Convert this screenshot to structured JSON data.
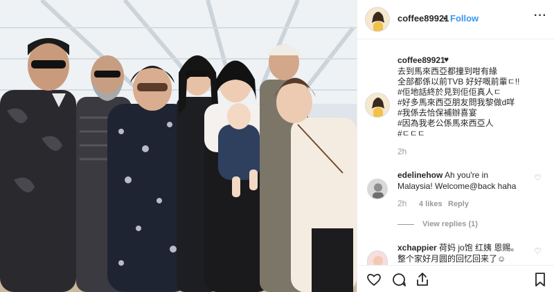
{
  "post": {
    "username": "coffee89921",
    "dot": "•",
    "follow_label": "Follow",
    "more_label": "···",
    "caption_heart": "♥",
    "caption_lines": [
      "去到馬來西亞都撞到咁有緣",
      "全部都係以前TVB 好好嘅前輩ㄷ!!",
      "#佢地話終於見到佢佢真人ㄷ",
      "#好多馬來西亞朋友問我黎做d咩",
      "#我係去恰保補辦喜宴",
      "#因為我老公係馬來西亞人",
      "#ㄷㄷㄷ"
    ],
    "caption_time": "2h"
  },
  "comments": [
    {
      "username": "edelinehow",
      "text_line1": "Ah you're in",
      "text_line2": "Malaysia! Welcome@back haha",
      "time": "2h",
      "likes": "4 likes",
      "reply_label": "Reply",
      "heart": "♡"
    },
    {
      "username": "xchappier",
      "text_line1": "荷妈 jo饱 红姨 恩赐。",
      "text_line2": "整个家好月圆的回忆回来了☺",
      "heart": "♡"
    }
  ],
  "view_replies": "View replies (1)",
  "icons": {
    "like": "heart-outline-icon",
    "comment": "comment-bubble-icon",
    "share": "share-icon",
    "save": "bookmark-icon"
  },
  "colors": {
    "follow": "#3897f0",
    "text": "#262626",
    "muted": "#999999"
  }
}
